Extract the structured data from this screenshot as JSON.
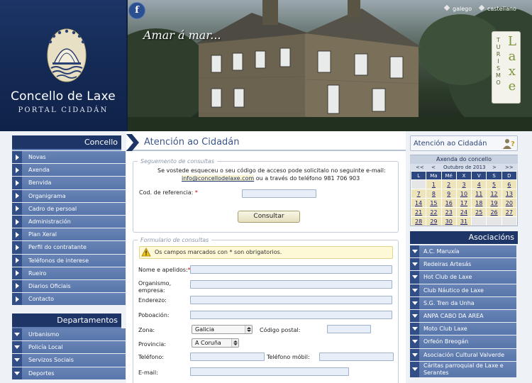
{
  "header": {
    "site_title": "Concello de Laxe",
    "site_subtitle": "PORTAL CIDADÁN",
    "tagline": "Amar á mar...",
    "facebook_label": "f",
    "languages": [
      "galego",
      "castellano"
    ],
    "turismo_label": "TURISMO",
    "laxe_label": "Laxe"
  },
  "left_sidebar": {
    "concello_heading": "Concello",
    "concello_items": [
      "Novas",
      "Axenda",
      "Benvida",
      "Organigrama",
      "Cadro de persoal",
      "Administración",
      "Plan Xeral",
      "Perfil do contratante",
      "Teléfonos de interese",
      "Rueiro",
      "Diarios Oficiais",
      "Contacto"
    ],
    "departamentos_heading": "Departamentos",
    "departamentos_items": [
      "Urbanismo",
      "Policía Local",
      "Servizos Sociais",
      "Deportes"
    ]
  },
  "main": {
    "title": "Atención ao Cidadán",
    "consult": {
      "legend": "Seguemento de consultas",
      "help_line1": "Se vostede esqueceu o seu código de acceso pode solicitalo no seguinte e-mail:",
      "help_email": "info@concellodelaxe.com",
      "help_line2_rest": " ou a través do teléfono 981 706 903",
      "ref_label": "Cod. de referencia:",
      "ref_value": "",
      "button_label": "Consultar"
    },
    "form": {
      "legend": "Formulario de consultas",
      "notice": "Os campos marcados con * son obrigatorios.",
      "name_label": "Nome e apelidos:",
      "org_label_1": "Organismo,",
      "org_label_2": "empresa:",
      "address_label": "Enderezo:",
      "town_label": "Poboación:",
      "zone_label": "Zona:",
      "zone_value": "Galicia",
      "postal_label": "Código postal:",
      "province_label": "Provincia:",
      "province_value": "A Coruña",
      "phone_label": "Teléfono:",
      "mobile_label": "Teléfono móbil:",
      "email_label": "E-mail:",
      "required_mark": "*"
    }
  },
  "right_sidebar": {
    "title": "Atención ao Cidadán",
    "calendar": {
      "title": "Axenda do concello",
      "nav_prev_year": "<<",
      "nav_prev": "<",
      "month": "Outubro de 2013",
      "nav_next": ">",
      "nav_next_year": ">>",
      "weekdays": [
        "L",
        "Ma",
        "Mé",
        "X",
        "V",
        "S",
        "D"
      ],
      "weeks": [
        [
          "",
          "1",
          "2",
          "3",
          "4",
          "5",
          "6"
        ],
        [
          "7",
          "8",
          "9",
          "10",
          "11",
          "12",
          "13"
        ],
        [
          "14",
          "15",
          "16",
          "17",
          "18",
          "19",
          "20"
        ],
        [
          "21",
          "22",
          "23",
          "24",
          "25",
          "26",
          "27"
        ],
        [
          "28",
          "29",
          "30",
          "31",
          "",
          "",
          ""
        ]
      ]
    },
    "assoc_heading": "Asociacións",
    "assoc_items": [
      "A.C. Maruxía",
      "Redeiras Artesás",
      "Hot Club de Laxe",
      "Club Náutico de Laxe",
      "S.G. Tren da Unha",
      "ANPA CABO DA AREA",
      "Moto Club Laxe",
      "Orfeón Breogán",
      "Asociación Cultural Valverde",
      "Cáritas parroquial de Laxe e Serantes"
    ]
  },
  "colors": {
    "nav_blue": "#5876ab",
    "heading_blue": "#1d3567",
    "title_blue": "#3c5688",
    "input_bg": "#e8eef8",
    "calendar_day": "#ede5b9"
  }
}
